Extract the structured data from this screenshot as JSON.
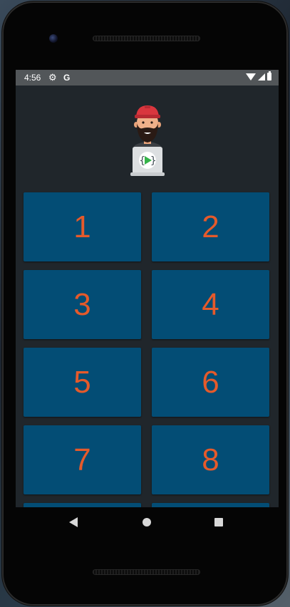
{
  "status_bar": {
    "time": "4:56",
    "settings_icon": "gear-icon",
    "google_icon": "G",
    "wifi_icon": "wifi-icon",
    "signal_icon": "cell-signal-icon",
    "battery_icon": "battery-icon"
  },
  "header": {
    "logo_icon": "developer-with-laptop-logo"
  },
  "keypad": {
    "keys": [
      {
        "label": "1"
      },
      {
        "label": "2"
      },
      {
        "label": "3"
      },
      {
        "label": "4"
      },
      {
        "label": "5"
      },
      {
        "label": "6"
      },
      {
        "label": "7"
      },
      {
        "label": "8"
      },
      {
        "label": ""
      },
      {
        "label": ""
      }
    ]
  },
  "nav_bar": {
    "back_icon": "back-triangle-icon",
    "home_icon": "home-circle-icon",
    "recents_icon": "recents-square-icon"
  },
  "colors": {
    "screen_background": "#20262b",
    "key_background": "#034d75",
    "key_text": "#e55a2b",
    "status_bar": "#525659"
  }
}
